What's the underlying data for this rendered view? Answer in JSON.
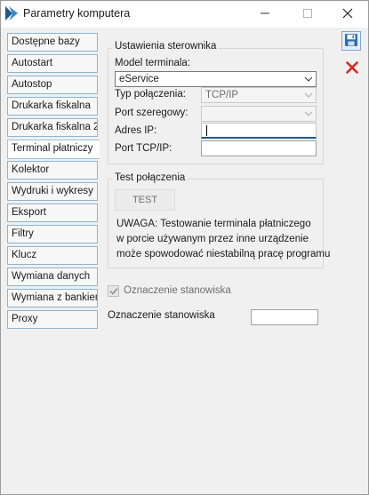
{
  "window": {
    "title": "Parametry komputera",
    "accent": "#1f5a8a"
  },
  "sidebar": {
    "items": [
      {
        "label": "Dostępne bazy"
      },
      {
        "label": "Autostart"
      },
      {
        "label": "Autostop"
      },
      {
        "label": "Drukarka fiskalna"
      },
      {
        "label": "Drukarka fiskalna 2"
      },
      {
        "label": "Terminal płatniczy",
        "active": true
      },
      {
        "label": "Kolektor"
      },
      {
        "label": "Wydruki i wykresy"
      },
      {
        "label": "Eksport"
      },
      {
        "label": "Filtry"
      },
      {
        "label": "Klucz"
      },
      {
        "label": "Wymiana danych"
      },
      {
        "label": "Wymiana z bankiem"
      },
      {
        "label": "Proxy"
      }
    ]
  },
  "terminal_settings": {
    "group_title": "Ustawienia sterownika",
    "model_label": "Model terminala:",
    "model_value": "eService",
    "connection_type_label": "Typ połączenia:",
    "connection_type_value": "TCP/IP",
    "serial_port_label": "Port szeregowy:",
    "serial_port_value": "",
    "ip_label": "Adres IP:",
    "ip_value": "",
    "tcp_port_label": "Port TCP/IP:",
    "tcp_port_value": ""
  },
  "connection_test": {
    "group_title": "Test połączenia",
    "test_button": "TEST",
    "warning_lines": [
      "UWAGA: Testowanie terminala płatniczego",
      "w porcie używanym przez inne urządzenie",
      "może spowodować niestabilną pracę programu"
    ]
  },
  "workstation": {
    "checkbox_label": "Oznaczenie stanowiska",
    "checkbox_checked": true,
    "checkbox_enabled": false,
    "field_label": "Oznaczenie stanowiska",
    "field_value": ""
  },
  "icons": {
    "app": "app-logo-icon",
    "minimize": "minimize-icon",
    "maximize": "maximize-icon",
    "close": "close-icon",
    "save": "save-disk-icon",
    "cancel": "cancel-x-icon"
  }
}
